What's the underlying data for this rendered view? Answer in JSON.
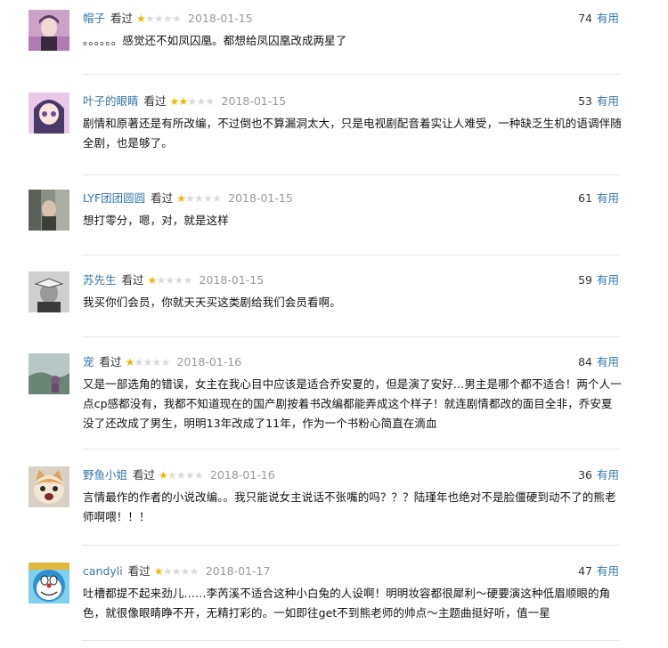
{
  "useful_label": "有用",
  "status_label": "看过",
  "star_color": "#f4b400",
  "link_color": "#3377aa",
  "comments": [
    {
      "user": "帽子",
      "status": "看过",
      "rating": 1,
      "date": "2018-01-15",
      "votes": "74",
      "text": "。。。。。。感觉还不如凤囚凰。都想给凤囚凰改成两星了",
      "avatar_icon": "avatar-person-purple-icon"
    },
    {
      "user": "叶子的眼睛",
      "status": "看过",
      "rating": 2,
      "date": "2018-01-15",
      "votes": "53",
      "text": "剧情和原著还是有所改编，不过倒也不算漏洞太大，只是电视剧配音着实让人难受，一种缺乏生机的语调伴随全剧，也是够了。",
      "avatar_icon": "avatar-anime-girl-icon"
    },
    {
      "user": "LYF团团圆圆",
      "status": "看过",
      "rating": 1,
      "date": "2018-01-15",
      "votes": "61",
      "text": "想打零分，嗯，对，就是这样",
      "avatar_icon": "avatar-photo-icon"
    },
    {
      "user": "苏先生",
      "status": "看过",
      "rating": 1,
      "date": "2018-01-15",
      "votes": "59",
      "text": "我买你们会员，你就天天买这类剧给我们会员看啊。",
      "avatar_icon": "avatar-man-book-icon"
    },
    {
      "user": "宠",
      "status": "看过",
      "rating": 1,
      "date": "2018-01-16",
      "votes": "84",
      "text": "又是一部选角的错误，女主在我心目中应该是适合乔安夏的，但是演了安好…男主是哪个都不适合！两个人一点cp感都没有，我都不知道现在的国产剧按着书改编都能弄成这个样子！就连剧情都改的面目全非，乔安夏没了还改成了男生，明明13年改成了11年，作为一个书粉心简直在滴血",
      "avatar_icon": "avatar-landscape-icon"
    },
    {
      "user": "野鱼小姐",
      "status": "看过",
      "rating": 1,
      "date": "2018-01-16",
      "votes": "36",
      "text": "言情最作的作者的小说改编。。我只能说女主说话不张嘴的吗？？？陆瑾年也绝对不是脸僵硬到动不了的熊老师啊喂！！！",
      "avatar_icon": "avatar-cat-icon"
    },
    {
      "user": "candyli",
      "status": "看过",
      "rating": 1,
      "date": "2018-01-17",
      "votes": "47",
      "text": "吐槽都提不起来劲儿……李芮溪不适合这种小白兔的人设啊！明明妆容都很犀利～硬要演这种低眉顺眼的角色，就很像眼睛睁不开，无精打彩的。一如即往get不到熊老师的帅点～主题曲挺好听，值一星",
      "avatar_icon": "avatar-doraemon-icon"
    }
  ]
}
